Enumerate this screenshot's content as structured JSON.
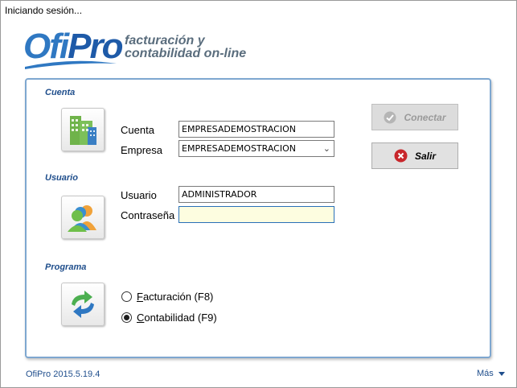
{
  "window": {
    "title": "Iniciando sesión..."
  },
  "logo": {
    "word_ofi": "Ofi",
    "word_pro": "Pro",
    "tagline_line1": "facturación y",
    "tagline_line2": "contabilidad on-line"
  },
  "cuenta": {
    "section_title": "Cuenta",
    "icon": "buildings-icon",
    "cuenta_label": "Cuenta",
    "cuenta_value": "EMPRESADEMOSTRACION",
    "empresa_label": "Empresa",
    "empresa_value": "EMPRESADEMOSTRACION"
  },
  "usuario": {
    "section_title": "Usuario",
    "icon": "users-icon",
    "usuario_label": "Usuario",
    "usuario_value": "ADMINISTRADOR",
    "password_label": "Contraseña",
    "password_value": ""
  },
  "programa": {
    "section_title": "Programa",
    "icon": "refresh-arrows-icon",
    "options": [
      {
        "label": "Facturación (F8)",
        "selected": false
      },
      {
        "label": "Contabilidad (F9)",
        "selected": true
      }
    ]
  },
  "buttons": {
    "connect_label": "Conectar",
    "connect_enabled": false,
    "exit_label": "Salir"
  },
  "footer": {
    "version": "OfiPro 2015.5.19.4",
    "more_label": "Más"
  },
  "colors": {
    "accent": "#1f4e8c",
    "panel_border": "#7ea7d0",
    "focus_fill": "#fdfde0",
    "exit_red": "#c8262b"
  }
}
